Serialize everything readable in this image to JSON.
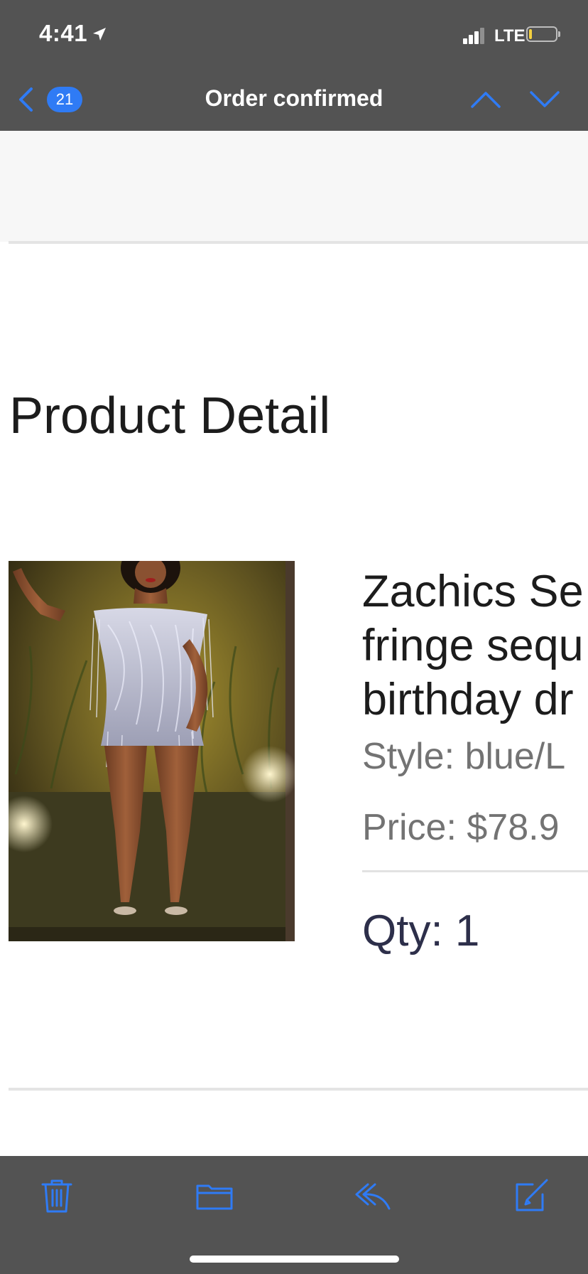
{
  "status_bar": {
    "time": "4:41",
    "network": "LTE",
    "signal_bars_filled": 3,
    "signal_bars_total": 4,
    "battery_level": 0.12,
    "battery_color": "#f4d03f"
  },
  "nav_bar": {
    "unread_count": "21",
    "title": "Order confirmed",
    "accent_color": "#2f7bf5"
  },
  "email": {
    "section_title": "Product Detail",
    "product": {
      "name_lines": [
        "Zachics Se",
        "fringe sequ",
        "birthday dr"
      ],
      "style": "Style: blue/L",
      "price": "Price: $78.9",
      "qty": "Qty: 1"
    }
  },
  "toolbar": {
    "icons": [
      "trash-icon",
      "folder-icon",
      "reply-icon",
      "compose-icon"
    ]
  }
}
